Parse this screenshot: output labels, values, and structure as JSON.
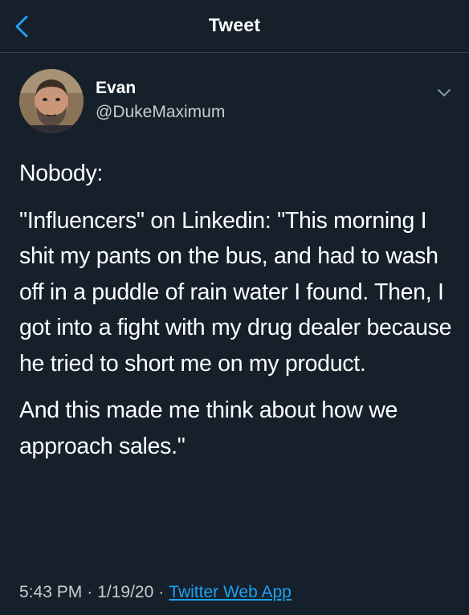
{
  "header": {
    "title": "Tweet",
    "back_icon": "chevron-left-icon",
    "accent_color": "#1da1f2"
  },
  "author": {
    "name": "Evan",
    "handle": "@DukeMaximum",
    "menu_icon": "chevron-down-icon"
  },
  "tweet": {
    "paragraphs": [
      "Nobody:",
      "\"Influencers\" on Linkedin: \"This morning I shit my pants on the bus, and had to wash off in a puddle of rain water I found. Then, I got into a fight with my drug dealer because he tried to short me on my product.",
      "And this made me think about how we approach sales.\""
    ]
  },
  "meta": {
    "time": "5:43 PM",
    "separator": "·",
    "date": "1/19/20",
    "source": "Twitter Web App"
  },
  "colors": {
    "background": "#15202b",
    "text": "#ffffff",
    "secondary_text": "#c7cdd2",
    "link": "#1da1f2",
    "divider": "#38444d"
  }
}
